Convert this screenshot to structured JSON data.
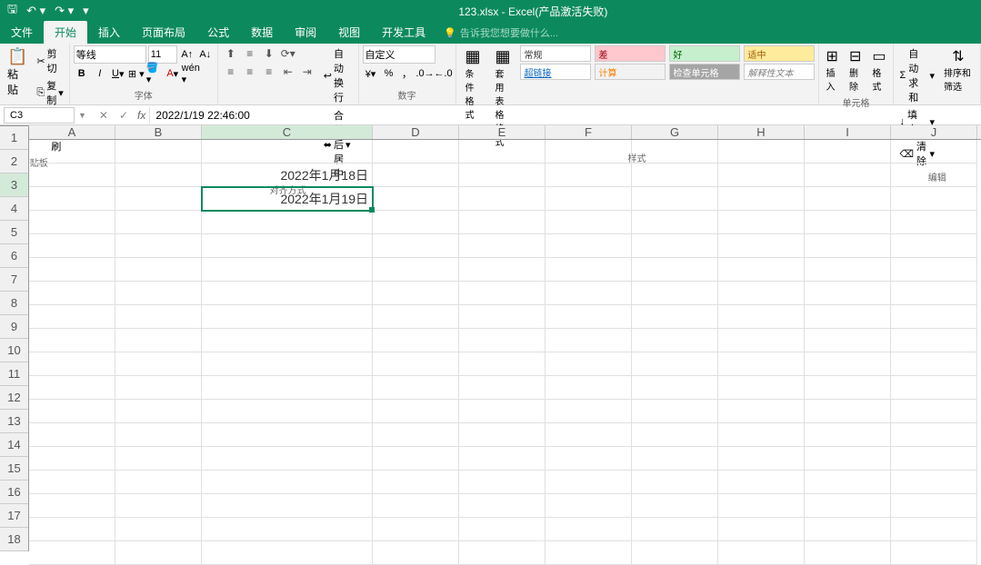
{
  "title": "123.xlsx - Excel(产品激活失败)",
  "tabs": {
    "file": "文件",
    "home": "开始",
    "insert": "插入",
    "layout": "页面布局",
    "formulas": "公式",
    "data": "数据",
    "review": "审阅",
    "view": "视图",
    "dev": "开发工具",
    "tellme": "告诉我您想要做什么..."
  },
  "clipboard": {
    "paste": "粘贴",
    "cut": "剪切",
    "copy": "复制",
    "formatpainter": "格式刷",
    "label": "剪贴板"
  },
  "font": {
    "name": "等线",
    "size": "11",
    "label": "字体"
  },
  "alignment": {
    "wrap": "自动换行",
    "merge": "合并后居中",
    "label": "对齐方式"
  },
  "number": {
    "format": "自定义",
    "label": "数字"
  },
  "styles": {
    "conditional": "条件格式",
    "table": "套用\n表格格式",
    "normal": "常规",
    "bad": "差",
    "good": "好",
    "neutral": "适中",
    "link": "超链接",
    "calc": "计算",
    "check": "检查单元格",
    "explain": "解释性文本",
    "label": "样式"
  },
  "cells": {
    "insert": "插入",
    "delete": "删除",
    "format": "格式",
    "label": "单元格"
  },
  "editing": {
    "autosum": "自动求和",
    "fill": "填充",
    "clear": "清除",
    "sort": "排序和筛选",
    "label": "编辑"
  },
  "namebox": "C3",
  "formula": "2022/1/19  22:46:00",
  "columns": [
    "A",
    "B",
    "C",
    "D",
    "E",
    "F",
    "G",
    "H",
    "I",
    "J"
  ],
  "rows": [
    "1",
    "2",
    "3",
    "4",
    "5",
    "6",
    "7",
    "8",
    "9",
    "10",
    "11",
    "12",
    "13",
    "14",
    "15",
    "16",
    "17",
    "18"
  ],
  "celldata": {
    "C2": "2022年1月18日",
    "C3": "2022年1月19日"
  },
  "selected": "C3"
}
